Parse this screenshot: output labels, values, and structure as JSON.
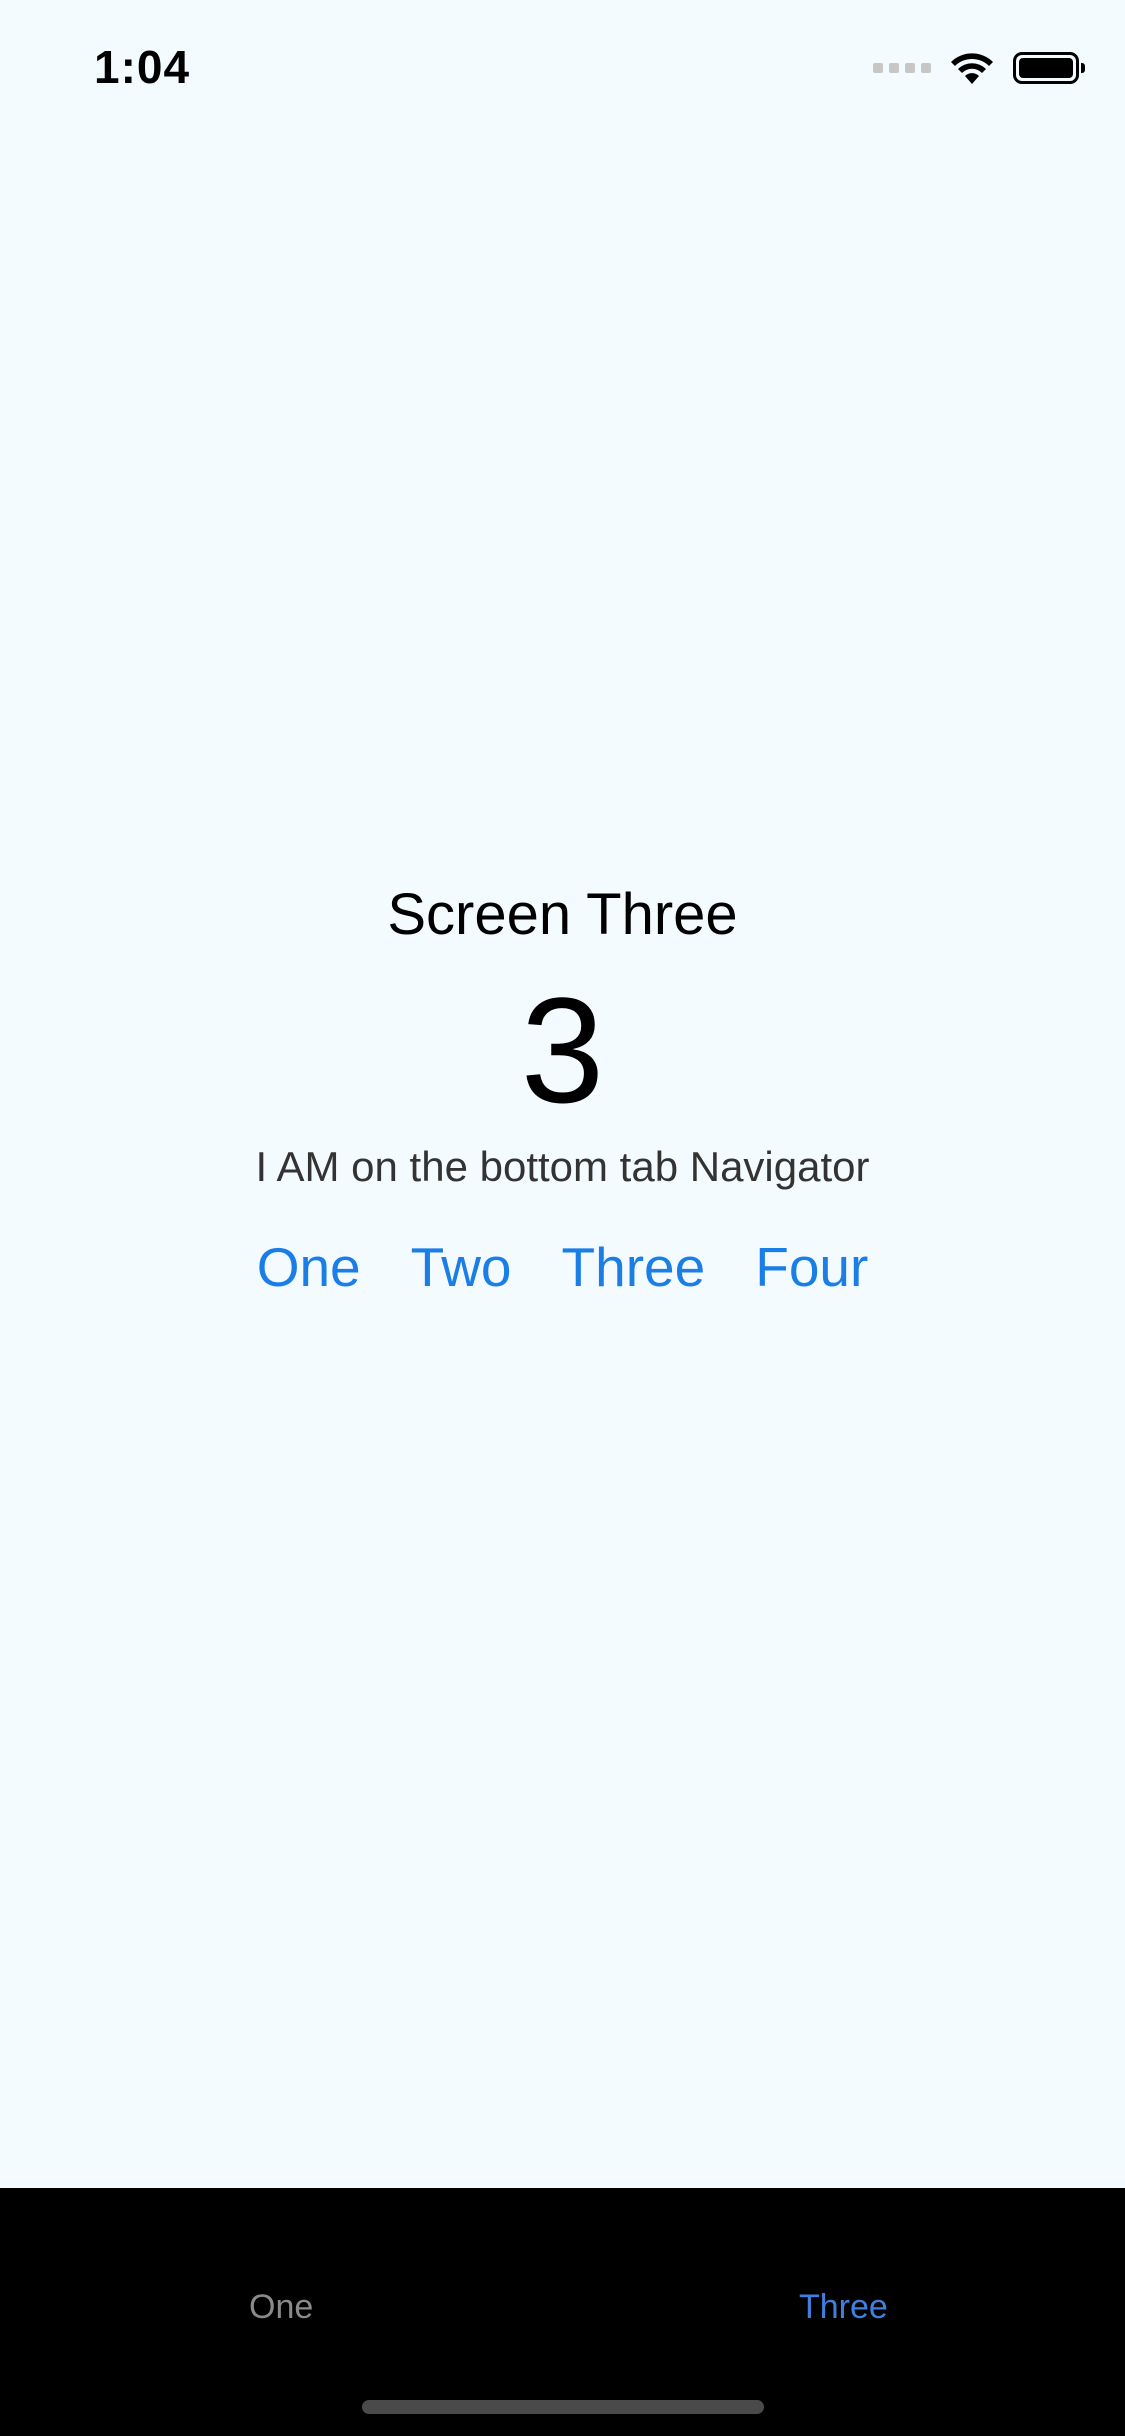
{
  "status_bar": {
    "time": "1:04",
    "icons": [
      "cellular-signal-icon",
      "wifi-icon",
      "battery-icon"
    ]
  },
  "screen": {
    "title": "Screen Three",
    "number": "3",
    "subtitle": "I AM on the bottom tab Navigator",
    "links": [
      "One",
      "Two",
      "Three",
      "Four"
    ]
  },
  "tab_bar": {
    "tabs": [
      {
        "label": "One",
        "active": false
      },
      {
        "label": "Three",
        "active": true
      }
    ]
  },
  "colors": {
    "background": "#f4fbff",
    "link": "#1a7ee6",
    "tab_bar": "#000000",
    "tab_active": "#3f7fe0",
    "tab_inactive": "#8a8a8a"
  }
}
